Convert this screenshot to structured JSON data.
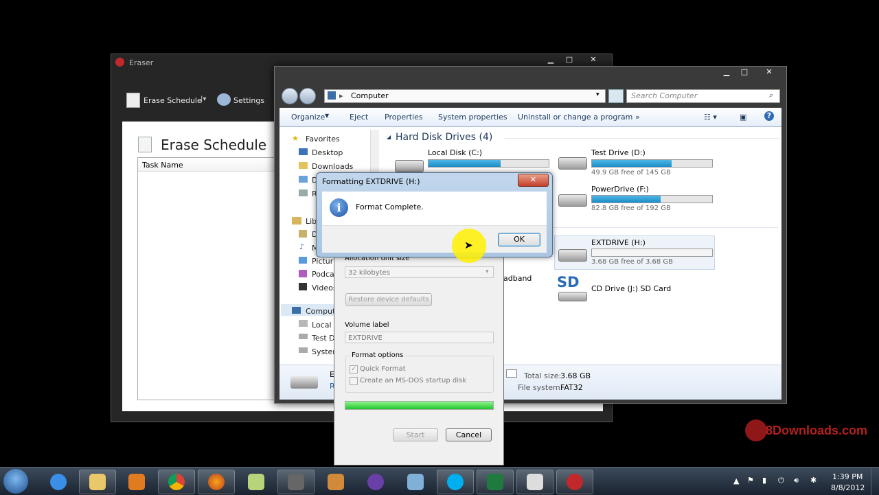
{
  "eraser": {
    "title": "Eraser",
    "toolbar": {
      "erase_schedule": "Erase Schedule",
      "settings": "Settings"
    },
    "heading": "Erase Schedule",
    "column_task_name": "Task Name"
  },
  "explorer": {
    "address": "Computer",
    "search_placeholder": "Search Computer",
    "commands": [
      "Organize",
      "Eject",
      "Properties",
      "System properties",
      "Uninstall or change a program",
      "»"
    ],
    "nav": {
      "favorites": "Favorites",
      "desktop": "Desktop",
      "downloads": "Downloads",
      "d_item": "D",
      "r_item": "R",
      "libraries": "Libr",
      "lib_d": "D",
      "music": "M",
      "pictures": "Pictur",
      "podcasts": "Podcas",
      "videos": "Videos",
      "computer": "Comput",
      "local": "Local",
      "test": "Test D",
      "system": "Syster"
    },
    "section_hdd": "Hard Disk Drives (4)",
    "drives": {
      "c": {
        "name": "Local Disk (C:)",
        "fill": 0.6
      },
      "d": {
        "name": "Test Drive (D:)",
        "free": "49.9 GB free of 145 GB",
        "fill": 0.66
      },
      "f": {
        "name": "PowerDrive (F:)",
        "free": "82.8 GB free of 192 GB",
        "fill": 0.57
      },
      "h": {
        "name": "EXTDRIVE (H:)",
        "free": "3.68 GB free of 3.68 GB",
        "fill": 0.0
      },
      "j": {
        "name": "CD Drive (J:) SD Card",
        "badge": "SD"
      }
    },
    "partial_broadband": "adband",
    "details": {
      "total_label": "Total size:",
      "total_value": "3.68 GB",
      "fs_label": "File system:",
      "fs_value": "FAT32",
      "partial_e": "E",
      "partial_r": "R"
    }
  },
  "format_dialog": {
    "alloc_label": "Allocation unit size",
    "alloc_value": "32 kilobytes",
    "restore_defaults": "Restore device defaults",
    "volume_label": "Volume label",
    "volume_value": "EXTDRIVE",
    "options_label": "Format options",
    "quick_format": "Quick Format",
    "msdos": "Create an MS-DOS startup disk",
    "progress": 1.0,
    "start": "Start",
    "cancel": "Cancel"
  },
  "popup": {
    "title": "Formatting EXTDRIVE (H:)",
    "message": "Format Complete.",
    "ok": "OK"
  },
  "watermark": "8Downloads.com",
  "taskbar": {
    "time": "1:39 PM",
    "date": "8/8/2012",
    "apps": [
      "internet-explorer-icon",
      "file-explorer-icon",
      "media-player-icon",
      "chrome-icon",
      "firefox-icon",
      "notes-icon",
      "tools-icon",
      "settings-app-icon",
      "torrent-icon",
      "mail-icon",
      "skype-icon",
      "excel-icon",
      "window-app-icon",
      "eraser-app-icon"
    ]
  },
  "colors": {
    "accent": "#1e395b",
    "progress": "#2fd53a",
    "drive_fill": "#1a8dc7"
  }
}
